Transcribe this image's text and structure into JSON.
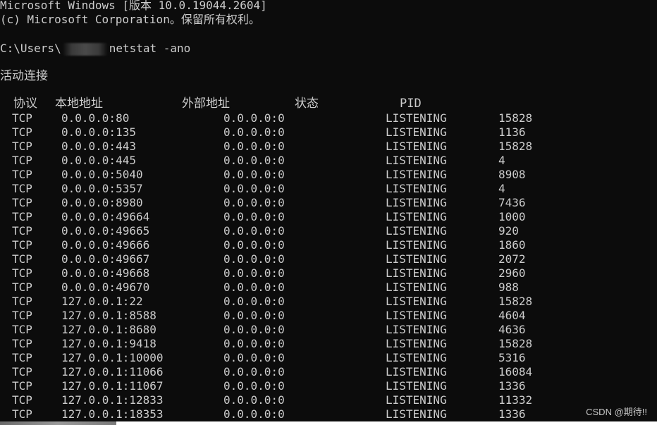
{
  "console": {
    "banner_line1": "Microsoft Windows [版本 10.0.19044.2604]",
    "banner_line2": "(c) Microsoft Corporation。保留所有权利。",
    "prompt_prefix": "C:\\Users\\",
    "prompt_command": "netstat -ano",
    "section_title": "活动连接"
  },
  "table": {
    "headers": {
      "proto": "协议",
      "local": "本地地址",
      "foreign": "外部地址",
      "state": "状态",
      "pid": "PID"
    },
    "rows": [
      {
        "proto": "TCP",
        "local": "0.0.0.0:80",
        "foreign": "0.0.0.0:0",
        "state": "LISTENING",
        "pid": "15828"
      },
      {
        "proto": "TCP",
        "local": "0.0.0.0:135",
        "foreign": "0.0.0.0:0",
        "state": "LISTENING",
        "pid": "1136"
      },
      {
        "proto": "TCP",
        "local": "0.0.0.0:443",
        "foreign": "0.0.0.0:0",
        "state": "LISTENING",
        "pid": "15828"
      },
      {
        "proto": "TCP",
        "local": "0.0.0.0:445",
        "foreign": "0.0.0.0:0",
        "state": "LISTENING",
        "pid": "4"
      },
      {
        "proto": "TCP",
        "local": "0.0.0.0:5040",
        "foreign": "0.0.0.0:0",
        "state": "LISTENING",
        "pid": "8908"
      },
      {
        "proto": "TCP",
        "local": "0.0.0.0:5357",
        "foreign": "0.0.0.0:0",
        "state": "LISTENING",
        "pid": "4"
      },
      {
        "proto": "TCP",
        "local": "0.0.0.0:8980",
        "foreign": "0.0.0.0:0",
        "state": "LISTENING",
        "pid": "7436"
      },
      {
        "proto": "TCP",
        "local": "0.0.0.0:49664",
        "foreign": "0.0.0.0:0",
        "state": "LISTENING",
        "pid": "1000"
      },
      {
        "proto": "TCP",
        "local": "0.0.0.0:49665",
        "foreign": "0.0.0.0:0",
        "state": "LISTENING",
        "pid": "920"
      },
      {
        "proto": "TCP",
        "local": "0.0.0.0:49666",
        "foreign": "0.0.0.0:0",
        "state": "LISTENING",
        "pid": "1860"
      },
      {
        "proto": "TCP",
        "local": "0.0.0.0:49667",
        "foreign": "0.0.0.0:0",
        "state": "LISTENING",
        "pid": "2072"
      },
      {
        "proto": "TCP",
        "local": "0.0.0.0:49668",
        "foreign": "0.0.0.0:0",
        "state": "LISTENING",
        "pid": "2960"
      },
      {
        "proto": "TCP",
        "local": "0.0.0.0:49670",
        "foreign": "0.0.0.0:0",
        "state": "LISTENING",
        "pid": "988"
      },
      {
        "proto": "TCP",
        "local": "127.0.0.1:22",
        "foreign": "0.0.0.0:0",
        "state": "LISTENING",
        "pid": "15828"
      },
      {
        "proto": "TCP",
        "local": "127.0.0.1:8588",
        "foreign": "0.0.0.0:0",
        "state": "LISTENING",
        "pid": "4604"
      },
      {
        "proto": "TCP",
        "local": "127.0.0.1:8680",
        "foreign": "0.0.0.0:0",
        "state": "LISTENING",
        "pid": "4636"
      },
      {
        "proto": "TCP",
        "local": "127.0.0.1:9418",
        "foreign": "0.0.0.0:0",
        "state": "LISTENING",
        "pid": "15828"
      },
      {
        "proto": "TCP",
        "local": "127.0.0.1:10000",
        "foreign": "0.0.0.0:0",
        "state": "LISTENING",
        "pid": "5316"
      },
      {
        "proto": "TCP",
        "local": "127.0.0.1:11066",
        "foreign": "0.0.0.0:0",
        "state": "LISTENING",
        "pid": "16084"
      },
      {
        "proto": "TCP",
        "local": "127.0.0.1:11067",
        "foreign": "0.0.0.0:0",
        "state": "LISTENING",
        "pid": "1336"
      },
      {
        "proto": "TCP",
        "local": "127.0.0.1:12833",
        "foreign": "0.0.0.0:0",
        "state": "LISTENING",
        "pid": "11332"
      },
      {
        "proto": "TCP",
        "local": "127.0.0.1:18353",
        "foreign": "0.0.0.0:0",
        "state": "LISTENING",
        "pid": "1336"
      }
    ]
  },
  "watermark": "CSDN @期待!!",
  "colors": {
    "background": "#0c0c0c",
    "text": "#cccccc"
  }
}
